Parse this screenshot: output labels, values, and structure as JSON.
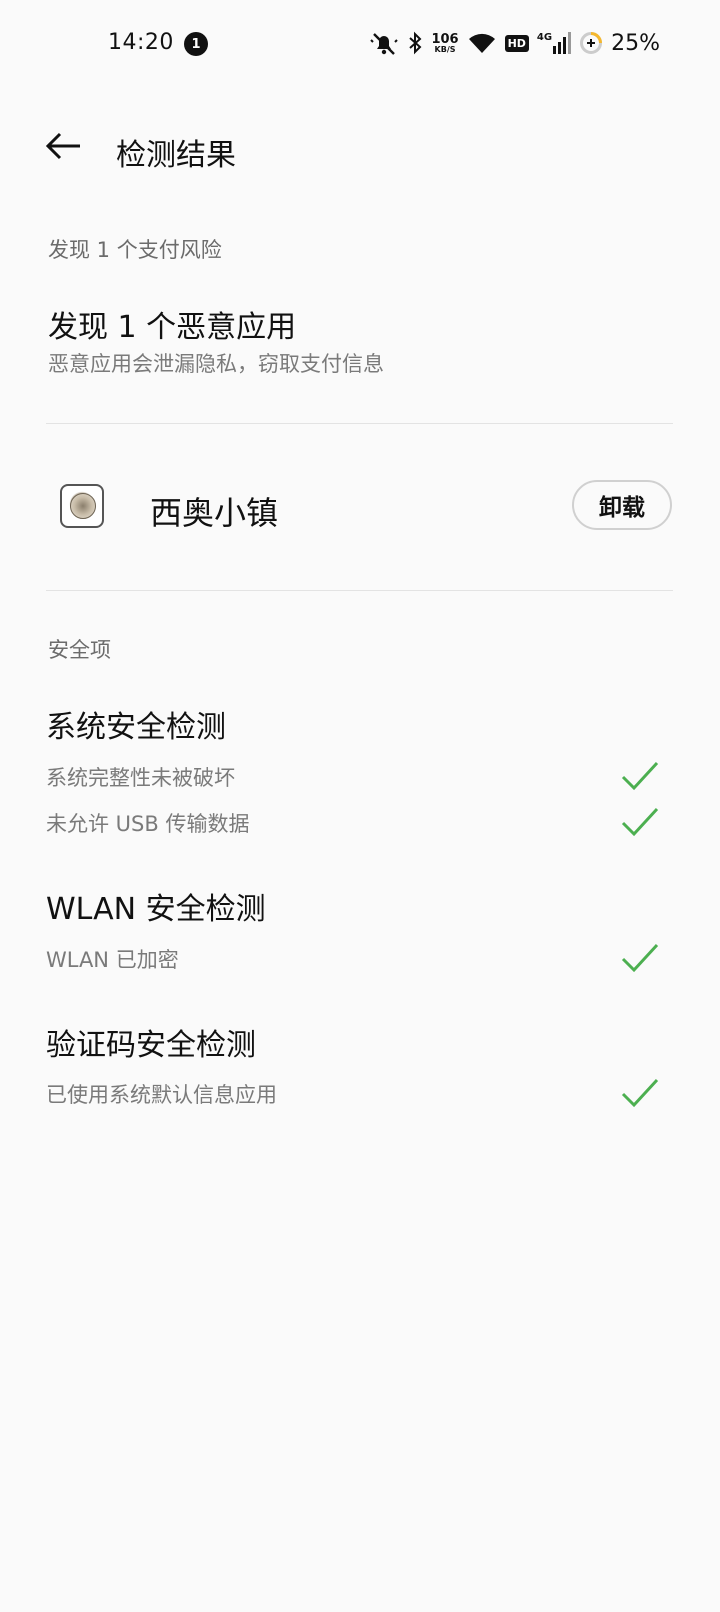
{
  "status_bar": {
    "time": "14:20",
    "notification_count": "1",
    "net_speed_value": "106",
    "net_speed_unit": "KB/S",
    "hd_label": "HD",
    "network_type": "4G",
    "battery_percent": "25%"
  },
  "header": {
    "title": "检测结果"
  },
  "risk_section": {
    "label": "发现 1 个支付风险",
    "heading": "发现 1 个恶意应用",
    "description": "恶意应用会泄漏隐私，窃取支付信息"
  },
  "malicious_app": {
    "name": "西奥小镇",
    "uninstall_label": "卸载"
  },
  "safety_section": {
    "label": "安全项",
    "groups": [
      {
        "title": "系统安全检测",
        "items": [
          "系统完整性未被破坏",
          "未允许 USB 传输数据"
        ]
      },
      {
        "title": "WLAN 安全检测",
        "items": [
          "WLAN 已加密"
        ]
      },
      {
        "title": "验证码安全检测",
        "items": [
          "已使用系统默认信息应用"
        ]
      }
    ]
  },
  "colors": {
    "check": "#4caf50",
    "background": "#fafafa"
  },
  "icons": [
    "back-arrow-icon",
    "bell-muted-icon",
    "bluetooth-icon",
    "wifi-icon",
    "signal-icon",
    "battery-saver-icon",
    "check-icon"
  ]
}
